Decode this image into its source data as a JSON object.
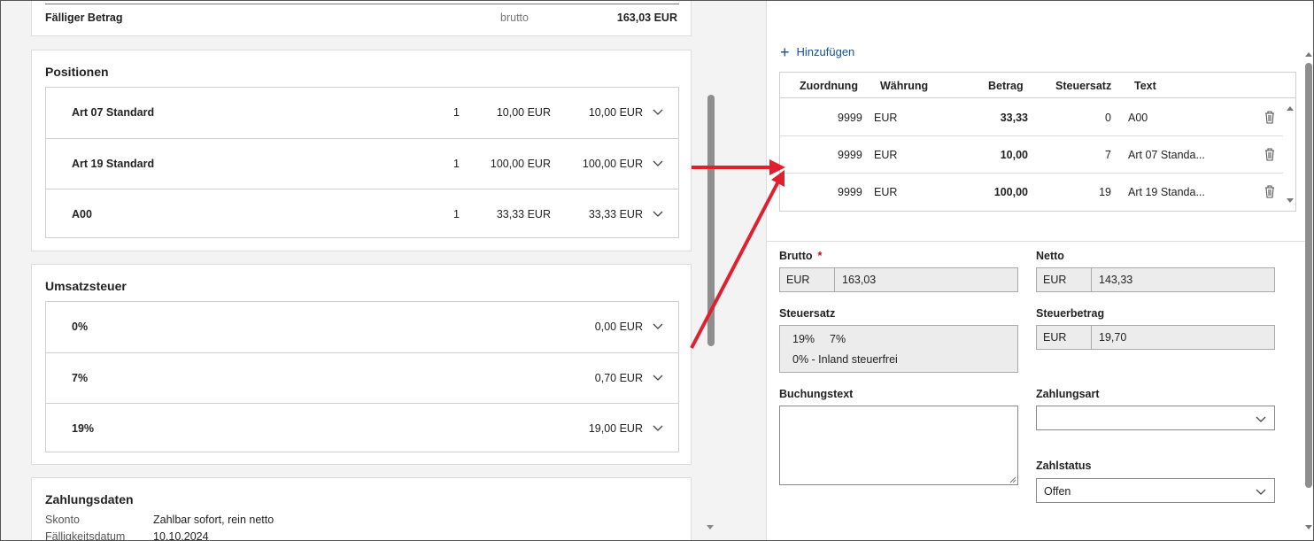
{
  "summary": {
    "label": "Fälliger Betrag",
    "mode": "brutto",
    "amount": "163,03 EUR"
  },
  "positions": {
    "title": "Positionen",
    "items": [
      {
        "name": "Art 07 Standard",
        "qty": "1",
        "price": "10,00 EUR",
        "total": "10,00 EUR"
      },
      {
        "name": "Art 19 Standard",
        "qty": "1",
        "price": "100,00 EUR",
        "total": "100,00 EUR"
      },
      {
        "name": "A00",
        "qty": "1",
        "price": "33,33 EUR",
        "total": "33,33 EUR"
      }
    ]
  },
  "vat": {
    "title": "Umsatzsteuer",
    "items": [
      {
        "rate": "0%",
        "amount": "0,00 EUR"
      },
      {
        "rate": "7%",
        "amount": "0,70 EUR"
      },
      {
        "rate": "19%",
        "amount": "19,00 EUR"
      }
    ]
  },
  "payment": {
    "title": "Zahlungsdaten",
    "rows": [
      {
        "label": "Skonto",
        "value": "Zahlbar sofort, rein netto"
      },
      {
        "label": "Fälligkeitsdatum",
        "value": "10.10.2024"
      }
    ]
  },
  "booking": {
    "add_label": "Hinzufügen",
    "columns": [
      "Zuordnung",
      "Währung",
      "Betrag",
      "Steuersatz",
      "Text"
    ],
    "rows": [
      {
        "assign": "9999",
        "currency": "EUR",
        "amount": "33,33",
        "tax": "0",
        "text": "A00"
      },
      {
        "assign": "9999",
        "currency": "EUR",
        "amount": "10,00",
        "tax": "7",
        "text": "Art 07 Standa..."
      },
      {
        "assign": "9999",
        "currency": "EUR",
        "amount": "100,00",
        "tax": "19",
        "text": "Art 19 Standa..."
      }
    ]
  },
  "form": {
    "brutto": {
      "label": "Brutto",
      "required": "*",
      "currency": "EUR",
      "value": "163,03"
    },
    "netto": {
      "label": "Netto",
      "currency": "EUR",
      "value": "143,33"
    },
    "steuersatz": {
      "label": "Steuersatz",
      "opt1": "19%",
      "opt2": "7%",
      "opt3": "0% - Inland steuerfrei"
    },
    "steuerbetrag": {
      "label": "Steuerbetrag",
      "currency": "EUR",
      "value": "19,70"
    },
    "buchungstext": {
      "label": "Buchungstext",
      "value": ""
    },
    "zahlungsart": {
      "label": "Zahlungsart",
      "value": ""
    },
    "zahlstatus": {
      "label": "Zahlstatus",
      "value": "Offen"
    }
  },
  "colors": {
    "accent": "#1a4f8a",
    "arrow": "#e0202e",
    "required": "#d0021b"
  }
}
